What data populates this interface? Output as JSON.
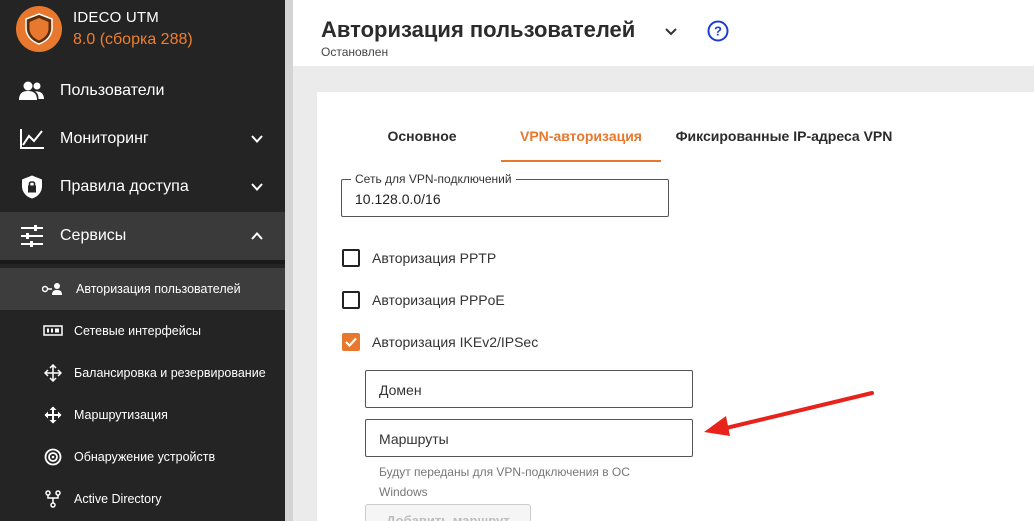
{
  "brand": {
    "title": "IDECO UTM",
    "version": "8.0 (сборка 288)",
    "accent": "#e8782d"
  },
  "sidebar": {
    "items": [
      {
        "label": "Пользователи",
        "icon": "users-icon"
      },
      {
        "label": "Мониторинг",
        "icon": "chart-line-icon",
        "chevron": "down"
      },
      {
        "label": "Правила доступа",
        "icon": "shield-lock-icon",
        "chevron": "down"
      },
      {
        "label": "Сервисы",
        "icon": "sliders-icon",
        "chevron": "up"
      }
    ],
    "subitems": [
      {
        "label": "Авторизация пользователей",
        "icon": "user-key-icon",
        "active": true
      },
      {
        "label": "Сетевые интерфейсы",
        "icon": "network-card-icon"
      },
      {
        "label": "Балансировка и резервирование",
        "icon": "balance-arrows-icon"
      },
      {
        "label": "Маршрутизация",
        "icon": "route-arrows-icon"
      },
      {
        "label": "Обнаружение устройств",
        "icon": "radar-icon"
      },
      {
        "label": "Active Directory",
        "icon": "directory-tree-icon"
      }
    ]
  },
  "header": {
    "title": "Авторизация пользователей",
    "status": "Остановлен"
  },
  "tabs": [
    {
      "label": "Основное"
    },
    {
      "label": "VPN-авторизация",
      "active": true
    },
    {
      "label": "Фиксированные IP-адреса VPN"
    }
  ],
  "form": {
    "vpn_network": {
      "legend": "Сеть для VPN-подключений",
      "value": "10.128.0.0/16"
    },
    "checkboxes": [
      {
        "label": "Авторизация PPTP",
        "checked": false
      },
      {
        "label": "Авторизация PPPoE",
        "checked": false
      },
      {
        "label": "Авторизация IKEv2/IPSec",
        "checked": true
      }
    ],
    "domain_placeholder": "Домен",
    "routes_placeholder": "Маршруты",
    "routes_hint": "Будут переданы для VPN-подключения в ОС Windows",
    "add_route_label": "Добавить маршрут"
  },
  "annotation": {
    "arrow_color": "#e8231c"
  }
}
